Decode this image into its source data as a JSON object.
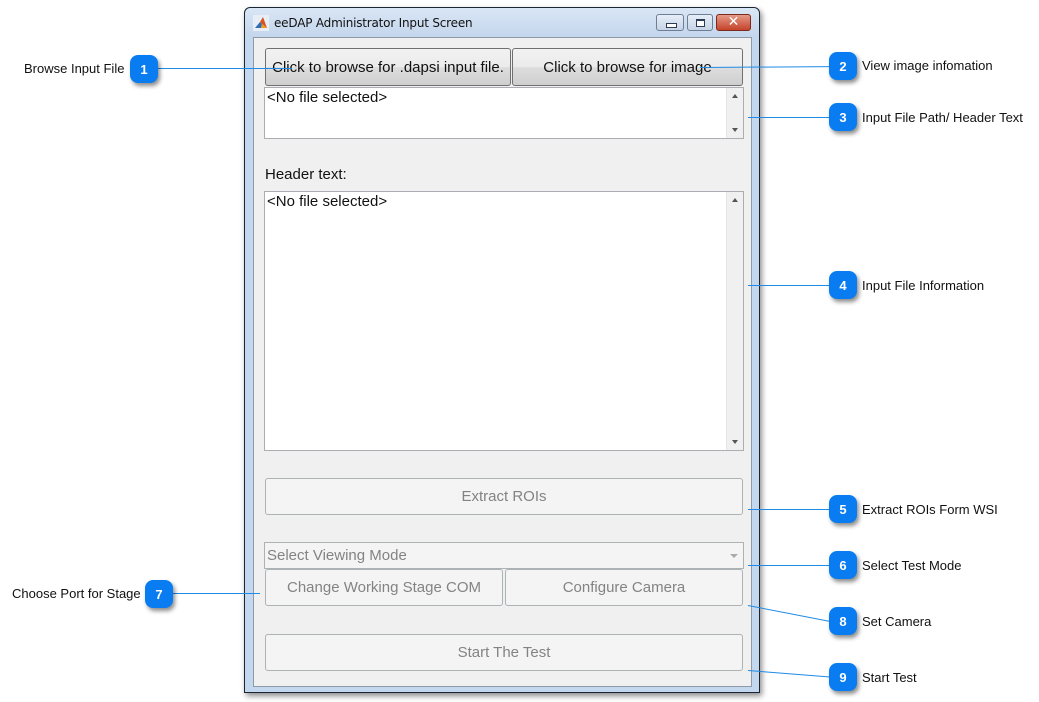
{
  "window": {
    "title": "eeDAP Administrator Input Screen",
    "app_icon": "matlab-icon",
    "controls": {
      "minimize": "minimize-icon",
      "maximize": "maximize-icon",
      "close": "close-icon",
      "close_glyph": "✕"
    }
  },
  "form": {
    "browse_input_button": "Click to browse for .dapsi input file.",
    "browse_image_button": "Click to browse for image",
    "file_path_text": "<No file selected>",
    "header_label": "Header text:",
    "header_text": "<No file selected>",
    "extract_rois_button": "Extract ROIs",
    "viewing_mode_select": "Select Viewing Mode",
    "change_stage_com_button": "Change Working Stage COM",
    "configure_camera_button": "Configure Camera",
    "start_test_button": "Start The Test"
  },
  "callouts": [
    {
      "number": "1",
      "label": "Browse Input File"
    },
    {
      "number": "2",
      "label": "View image infomation"
    },
    {
      "number": "3",
      "label": "Input File Path/ Header Text"
    },
    {
      "number": "4",
      "label": "Input File Information"
    },
    {
      "number": "5",
      "label": "Extract ROIs Form WSI"
    },
    {
      "number": "6",
      "label": "Select Test Mode"
    },
    {
      "number": "7",
      "label": "Choose Port for Stage"
    },
    {
      "number": "8",
      "label": "Set Camera"
    },
    {
      "number": "9",
      "label": "Start Test"
    }
  ],
  "colors": {
    "callout_badge": "#0a7cf2",
    "callout_line": "#1f8be4",
    "disabled_text": "#838383"
  }
}
